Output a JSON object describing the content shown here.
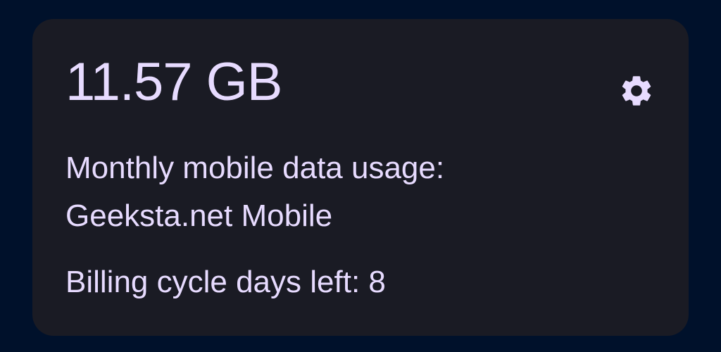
{
  "widget": {
    "usage_total": "11.57 GB",
    "description": "Monthly mobile data usage:",
    "carrier": "Geeksta.net Mobile",
    "billing_cycle": "Billing cycle days left: 8",
    "settings_icon": "gear-icon"
  },
  "colors": {
    "background": "#00112b",
    "card": "#1a1b24",
    "text": "#e7dbff"
  }
}
